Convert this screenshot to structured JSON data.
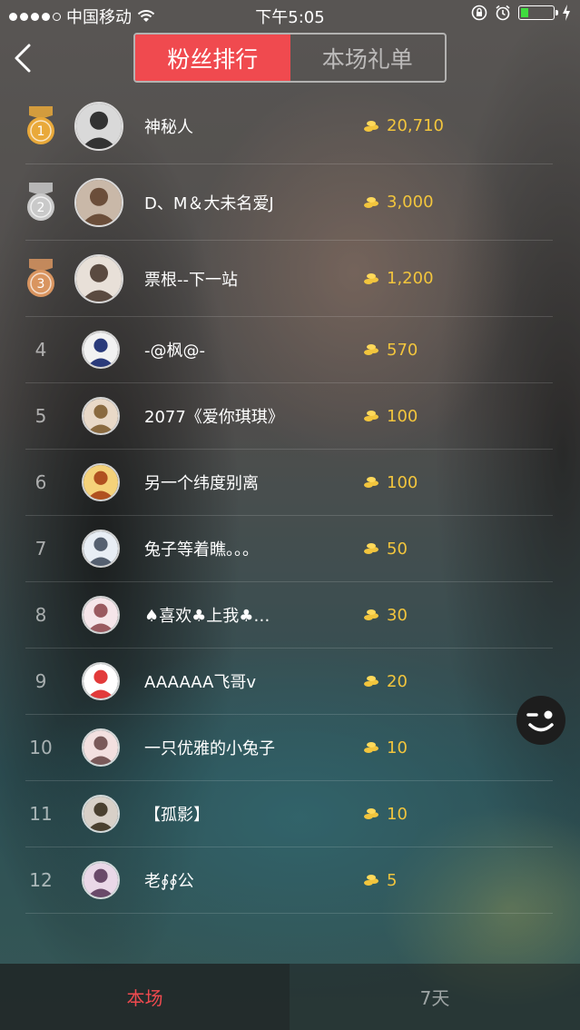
{
  "status_bar": {
    "carrier": "中国移动",
    "time": "下午5:05",
    "battery_level": 0.2,
    "icons": [
      "signal-dots-icon",
      "wifi-icon",
      "rotation-lock-icon",
      "alarm-icon",
      "battery-icon",
      "charging-icon"
    ]
  },
  "header": {
    "back_icon": "chevron-left-icon",
    "tabs": [
      {
        "label": "粉丝排行",
        "active": true
      },
      {
        "label": "本场礼单",
        "active": false
      }
    ]
  },
  "ranking": [
    {
      "rank": "1",
      "medal": "gold",
      "name": "神秘人",
      "score": "20,710"
    },
    {
      "rank": "2",
      "medal": "silver",
      "name": "D、M＆大未名爱J",
      "score": "3,000"
    },
    {
      "rank": "3",
      "medal": "bronze",
      "name": "票根--下一站",
      "score": "1,200"
    },
    {
      "rank": "4",
      "name": "-@枫@-",
      "score": "570"
    },
    {
      "rank": "5",
      "name": "2077《爱你琪琪》",
      "score": "100"
    },
    {
      "rank": "6",
      "name": "另一个纬度别离",
      "score": "100"
    },
    {
      "rank": "7",
      "name": "兔子等着瞧。。。",
      "score": "50"
    },
    {
      "rank": "8",
      "name": "♠喜欢♣上我♣…",
      "score": "30"
    },
    {
      "rank": "9",
      "name": "AAAAAA飞哥v",
      "score": "20"
    },
    {
      "rank": "10",
      "name": "一只优雅的小兔子",
      "score": "10"
    },
    {
      "rank": "11",
      "name": "【孤影】",
      "score": "10"
    },
    {
      "rank": "12",
      "name": "老∮∮公",
      "score": "5"
    }
  ],
  "colors": {
    "accent": "#f04a4f",
    "coin": "#f2c53d",
    "gold": "#e9a93a",
    "silver": "#c9c9c9",
    "bronze": "#d99560"
  },
  "floating_button": {
    "icon": "wink-face-icon"
  },
  "bottom_tabs": [
    {
      "label": "本场",
      "active": true
    },
    {
      "label": "7天",
      "active": false
    }
  ]
}
